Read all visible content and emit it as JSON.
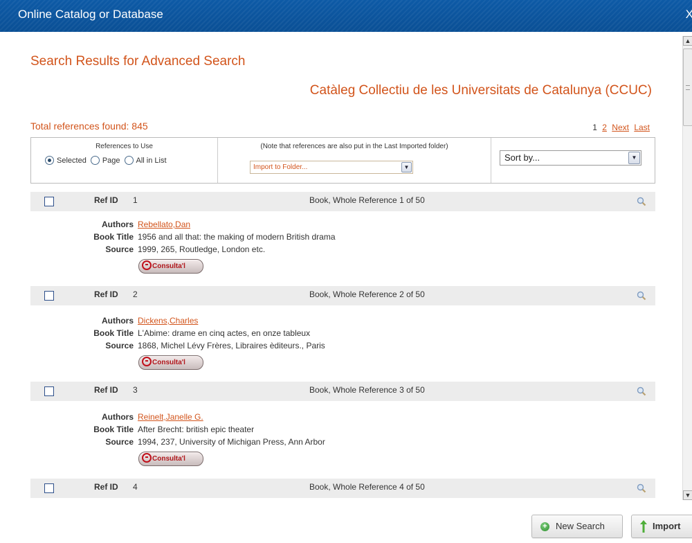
{
  "window": {
    "title": "Online Catalog or Database",
    "close_glyph": "X"
  },
  "heading": "Search Results for Advanced Search",
  "database_name": "Catàleg Collectiu de les Universitats de Catalunya (CCUC)",
  "total_found": "Total references found: 845",
  "pager": {
    "current": "1",
    "page2": "2",
    "next": "Next",
    "last": "Last"
  },
  "toolbar": {
    "refs_label": "References to Use",
    "radio_selected": "Selected",
    "radio_page": "Page",
    "radio_all": "All in List",
    "selected_radio": "Selected",
    "folder_note": "(Note that references are also put in the Last Imported folder)",
    "folder_select_value": "Import to Folder...",
    "sort_select_value": "Sort by..."
  },
  "references": [
    {
      "ref_id_label": "Ref ID",
      "ref_id": "1",
      "type_line": "Book, Whole Reference 1 of 50",
      "authors_label": "Authors",
      "authors": "Rebellato,Dan",
      "book_title_label": "Book Title",
      "book_title": "1956 and all that: the making of modern British drama",
      "source_label": "Source",
      "source": "1999, 265, Routledge, London etc.",
      "consulta": "Consulta'l"
    },
    {
      "ref_id_label": "Ref ID",
      "ref_id": "2",
      "type_line": "Book, Whole Reference 2 of 50",
      "authors_label": "Authors",
      "authors": "Dickens,Charles",
      "book_title_label": "Book Title",
      "book_title": "L'Abime: drame en cinq actes, en onze tableux",
      "source_label": "Source",
      "source": "1868, Michel Lévy Frères, Libraires èditeurs., Paris",
      "consulta": "Consulta'l"
    },
    {
      "ref_id_label": "Ref ID",
      "ref_id": "3",
      "type_line": "Book, Whole Reference 3 of 50",
      "authors_label": "Authors",
      "authors": "Reinelt,Janelle G.",
      "book_title_label": "Book Title",
      "book_title": "After Brecht: british epic theater",
      "source_label": "Source",
      "source": "1994, 237, University of Michigan Press, Ann Arbor",
      "consulta": "Consulta'l"
    },
    {
      "ref_id_label": "Ref ID",
      "ref_id": "4",
      "type_line": "Book, Whole Reference 4 of 50"
    }
  ],
  "buttons": {
    "new_search": "New Search",
    "import": "Import"
  },
  "colors": {
    "accent": "#d2541b",
    "titlebar": "#0d5aa6",
    "ref_bar": "#ececec"
  }
}
